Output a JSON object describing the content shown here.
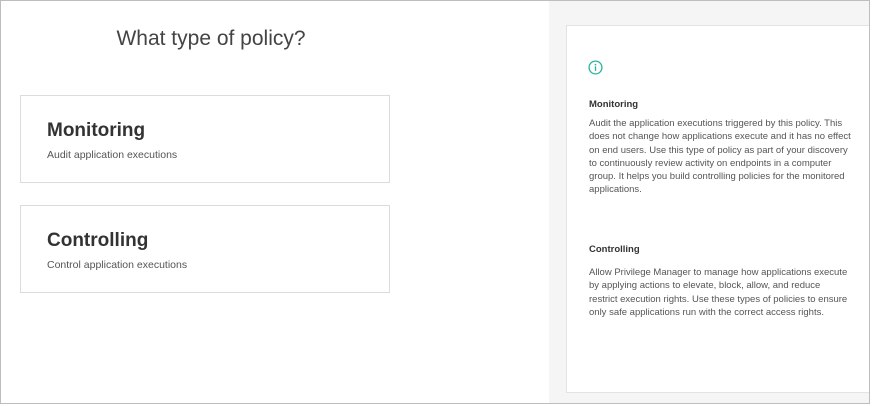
{
  "page": {
    "title": "What type of policy?"
  },
  "cards": [
    {
      "title": "Monitoring",
      "description": "Audit application executions"
    },
    {
      "title": "Controlling",
      "description": "Control application executions"
    }
  ],
  "info": {
    "icon": "info-circle-icon",
    "icon_color": "#2bb39a",
    "sections": [
      {
        "title": "Monitoring",
        "text": "Audit the application executions triggered by this policy. This does not change how applications execute and it has no effect on end users. Use this type of policy as part of your discovery to continuously review activity on endpoints in a computer group. It helps you build controlling policies for the monitored applications."
      },
      {
        "title": "Controlling",
        "text": "Allow Privilege Manager to manage how applications execute by applying actions to elevate, block, allow, and reduce restrict execution rights. Use these types of policies to ensure only safe applications run with the correct access rights."
      }
    ]
  }
}
